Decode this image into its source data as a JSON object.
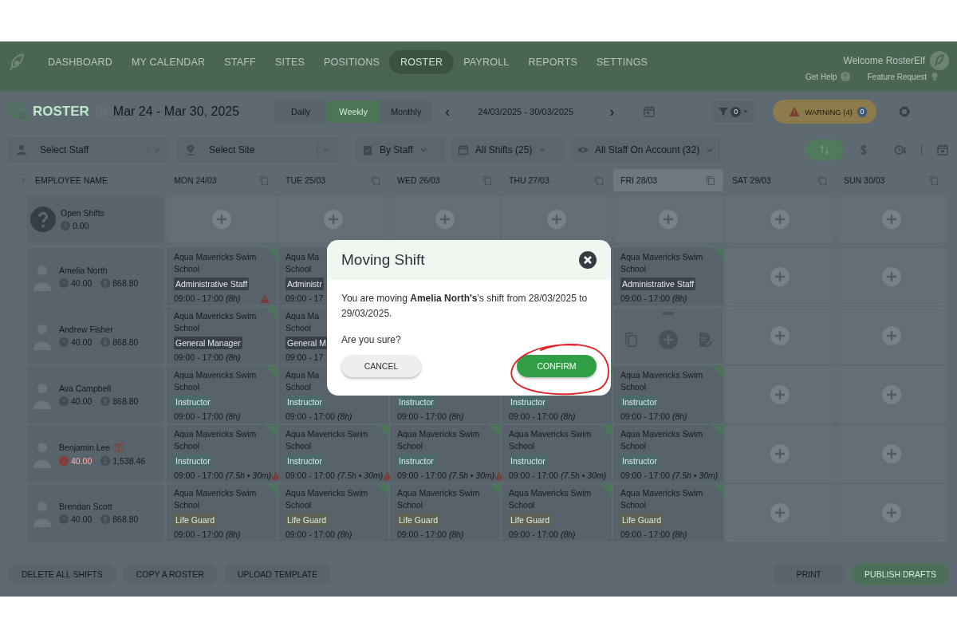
{
  "nav": {
    "items": [
      {
        "label": "DASHBOARD",
        "selected": false
      },
      {
        "label": "MY CALENDAR",
        "selected": false
      },
      {
        "label": "STAFF",
        "selected": false
      },
      {
        "label": "SITES",
        "selected": false
      },
      {
        "label": "POSITIONS",
        "selected": false
      },
      {
        "label": "ROSTER",
        "selected": true
      },
      {
        "label": "PAYROLL",
        "selected": false
      },
      {
        "label": "REPORTS",
        "selected": false
      },
      {
        "label": "SETTINGS",
        "selected": false
      }
    ],
    "welcome": "Welcome RosterElf",
    "links": [
      {
        "label": "Get Help",
        "kind": "help"
      },
      {
        "label": "Feature Request",
        "kind": "idea"
      }
    ]
  },
  "header": {
    "title": "ROSTER",
    "range": "Mar 24 - Mar 30, 2025",
    "views": [
      {
        "label": "Daily",
        "selected": false
      },
      {
        "label": "Weekly",
        "selected": true
      },
      {
        "label": "Monthly",
        "selected": false
      }
    ],
    "prev": "‹",
    "dates": "24/03/2025 - 30/03/2025",
    "next": "›",
    "filter_count": "0",
    "warning": "WARNING (4)",
    "warning_badge": "0"
  },
  "filters": {
    "staff": {
      "placeholder": "Select Staff"
    },
    "site": {
      "placeholder": "Select Site"
    },
    "group_by": "By Staff",
    "shifts": "All Shifts (25)",
    "staff_scope": "All Staff On Account (32)"
  },
  "grid": {
    "name_header": "EMPLOYEE NAME",
    "days": [
      {
        "label": "MON 24/03",
        "highlighted": false
      },
      {
        "label": "TUE 25/03",
        "highlighted": false
      },
      {
        "label": "WED 26/03",
        "highlighted": false
      },
      {
        "label": "THU 27/03",
        "highlighted": false
      },
      {
        "label": "FRI 28/03",
        "highlighted": true
      },
      {
        "label": "SAT 29/03",
        "highlighted": false
      },
      {
        "label": "SUN 30/03",
        "highlighted": false
      }
    ],
    "open_shifts": {
      "label": "Open Shifts",
      "hours": "0.00"
    },
    "rows": [
      {
        "name": "Amelia North",
        "hours": "40.00",
        "hours_alert": false,
        "swap_flag": false,
        "cost": "868.80",
        "cells": [
          {
            "kind": "shift",
            "site_lines": [
              "Aqua Mavericks Swim",
              "School"
            ],
            "position": "Administrative Staff",
            "color": "#394047",
            "time": "09:00 - 17:00",
            "duration": "(8h)",
            "warning": true
          },
          {
            "kind": "shift",
            "site_lines": [
              "Aqua Ma",
              "School"
            ],
            "position": "Administr",
            "color": "#394047",
            "time": "09:00 - 17",
            "warning": false
          },
          {
            "kind": "hidden"
          },
          {
            "kind": "hidden"
          },
          {
            "kind": "shift",
            "site_lines": [
              "Aqua Mavericks Swim",
              "School"
            ],
            "position": "Administrative Staff",
            "color": "#394047",
            "time": "09:00 - 17:00",
            "duration": "(8h)",
            "warning": false
          },
          {
            "kind": "empty"
          },
          {
            "kind": "empty"
          }
        ]
      },
      {
        "name": "Andrew Fisher",
        "hours": "40.00",
        "hours_alert": false,
        "swap_flag": false,
        "cost": "868.80",
        "cells": [
          {
            "kind": "shift",
            "site_lines": [
              "Aqua Mavericks Swim",
              "School"
            ],
            "position": "General Manager",
            "color": "#394047",
            "time": "09:00 - 17:00",
            "duration": "(8h)",
            "warning": false
          },
          {
            "kind": "shift",
            "site_lines": [
              "Aqua Ma",
              "School"
            ],
            "position": "General M",
            "color": "#394047",
            "time": "09:00 - 17",
            "warning": false
          },
          {
            "kind": "hidden"
          },
          {
            "kind": "hidden"
          },
          {
            "kind": "actions"
          },
          {
            "kind": "empty"
          },
          {
            "kind": "empty"
          }
        ]
      },
      {
        "name": "Ava Campbell",
        "hours": "40.00",
        "hours_alert": false,
        "swap_flag": false,
        "cost": "868.80",
        "cells": [
          {
            "kind": "shift",
            "site_lines": [
              "Aqua Mavericks Swim",
              "School"
            ],
            "position": "Instructor",
            "color": "#4a6a6a",
            "time": "09:00 - 17:00",
            "duration": "(8h)",
            "warning": false
          },
          {
            "kind": "shift",
            "site_lines": [
              "Aqua Ma",
              "School"
            ],
            "position": "Instructor",
            "color": "#4a6a6a",
            "time": "09:00 - 17:00",
            "duration": "(8h)",
            "warning": false
          },
          {
            "kind": "shift",
            "position": "Instructor",
            "color": "#4a6a6a",
            "time": "09:00 - 17:00",
            "duration": "(8h)",
            "warning": false
          },
          {
            "kind": "shift",
            "position": "Instructor",
            "color": "#4a6a6a",
            "time": "09:00 - 17:00",
            "duration": "(8h)",
            "warning": false
          },
          {
            "kind": "shift",
            "site_lines": [
              "Aqua Mavericks Swim",
              "School"
            ],
            "position": "Instructor",
            "color": "#4a6a6a",
            "time": "09:00 - 17:00",
            "duration": "(8h)",
            "warning": false
          },
          {
            "kind": "empty"
          },
          {
            "kind": "empty"
          }
        ]
      },
      {
        "name": "Benjamin Lee",
        "hours": "40.00",
        "hours_alert": true,
        "swap_flag": true,
        "cost": "1,538.46",
        "cells": [
          {
            "kind": "shift",
            "site_lines": [
              "Aqua Mavericks Swim",
              "School"
            ],
            "position": "Instructor",
            "color": "#4a6a6a",
            "time": "09:00 - 17:00",
            "duration": "(7.5h • 30m)",
            "warning": true
          },
          {
            "kind": "shift",
            "site_lines": [
              "Aqua Mavericks Swim",
              "School"
            ],
            "position": "Instructor",
            "color": "#4a6a6a",
            "time": "09:00 - 17:00",
            "duration": "(7.5h • 30m)",
            "warning": true
          },
          {
            "kind": "shift",
            "site_lines": [
              "Aqua Mavericks Swim",
              "School"
            ],
            "position": "Instructor",
            "color": "#4a6a6a",
            "time": "09:00 - 17:00",
            "duration": "(7.5h • 30m)",
            "warning": true
          },
          {
            "kind": "shift",
            "site_lines": [
              "Aqua Mavericks Swim",
              "School"
            ],
            "position": "Instructor",
            "color": "#4a6a6a",
            "time": "09:00 - 17:00",
            "duration": "(7.5h • 30m)",
            "warning": false
          },
          {
            "kind": "shift",
            "site_lines": [
              "Aqua Mavericks Swim",
              "School"
            ],
            "position": "Instructor",
            "color": "#4a6a6a",
            "time": "09:00 - 17:00",
            "duration": "(7.5h • 30m)",
            "warning": false
          },
          {
            "kind": "empty"
          },
          {
            "kind": "empty"
          }
        ]
      },
      {
        "name": "Brendan Scott",
        "hours": "40.00",
        "hours_alert": false,
        "swap_flag": false,
        "cost": "868.80",
        "cells": [
          {
            "kind": "shift",
            "site_lines": [
              "Aqua Mavericks Swim",
              "School"
            ],
            "position": "Life Guard",
            "color": "#5d6350",
            "time": "09:00 - 17:00",
            "duration": "(8h)",
            "warning": false
          },
          {
            "kind": "shift",
            "site_lines": [
              "Aqua Mavericks Swim",
              "School"
            ],
            "position": "Life Guard",
            "color": "#5d6350",
            "time": "09:00 - 17:00",
            "duration": "(8h)",
            "warning": false
          },
          {
            "kind": "shift",
            "site_lines": [
              "Aqua Mavericks Swim",
              "School"
            ],
            "position": "Life Guard",
            "color": "#5d6350",
            "time": "09:00 - 17:00",
            "duration": "(8h)",
            "warning": false
          },
          {
            "kind": "shift",
            "site_lines": [
              "Aqua Mavericks Swim",
              "School"
            ],
            "position": "Life Guard",
            "color": "#5d6350",
            "time": "09:00 - 17:00",
            "duration": "(8h)",
            "warning": false
          },
          {
            "kind": "shift",
            "site_lines": [
              "Aqua Mavericks Swim",
              "School"
            ],
            "position": "Life Guard",
            "color": "#5d6350",
            "time": "09:00 - 17:00",
            "duration": "(8h)",
            "warning": false
          },
          {
            "kind": "empty"
          },
          {
            "kind": "empty"
          }
        ]
      }
    ]
  },
  "modal": {
    "title": "Moving Shift",
    "message": "You are moving **Amelia North's**'s shift from 28/03/2025 to 29/03/2025.",
    "question": "Are you sure?",
    "cancel": "CANCEL",
    "confirm": "CONFIRM"
  },
  "footer": {
    "left": [
      "DELETE ALL SHIFTS",
      "COPY A ROSTER",
      "UPLOAD TEMPLATE"
    ],
    "print": "PRINT",
    "publish": "PUBLISH DRAFTS"
  }
}
